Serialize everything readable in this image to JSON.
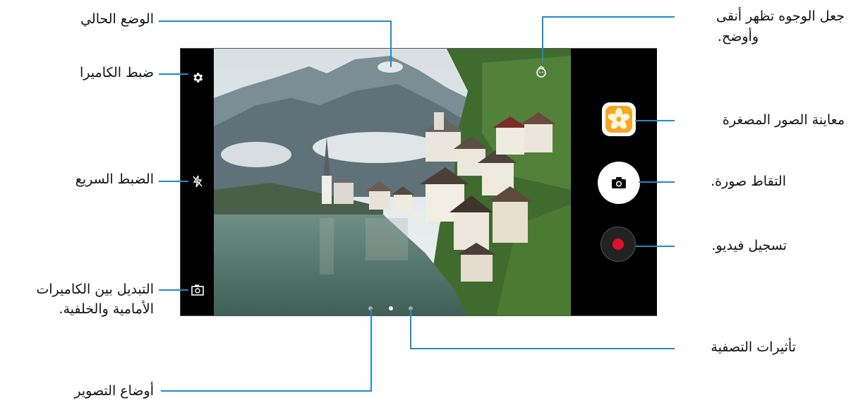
{
  "labels": {
    "current_mode": "الوضع الحالي",
    "camera_settings": "ضبط الكاميرا",
    "quick_settings": "الضبط السريع",
    "switch_cameras_line1": "التبديل بين الكاميرات",
    "switch_cameras_line2": "الأمامية والخلفية.",
    "shooting_modes": "أوضاع التصوير",
    "beauty_line1": "جعل الوجوه تظهر أنقى",
    "beauty_line2": "وأوضح.",
    "thumbnail_preview": "معاينة الصور المصغرة",
    "take_picture": "التقاط صورة.",
    "record_video": "تسجيل فيديو.",
    "filter_effects": "تأثيرات التصفية"
  },
  "colors": {
    "accent_line": "#1f8bd0",
    "record_red": "#e0102a",
    "thumbnail_orange": "#f5a623"
  },
  "icons": {
    "settings": "gear-icon",
    "flash_off": "flash-off-icon",
    "switch_camera": "switch-camera-icon",
    "beauty": "beauty-face-icon",
    "shutter": "camera-icon",
    "record": "record-icon",
    "thumbnail": "flower-thumbnail-icon"
  },
  "mode_pages": 3,
  "active_mode_page": 2
}
